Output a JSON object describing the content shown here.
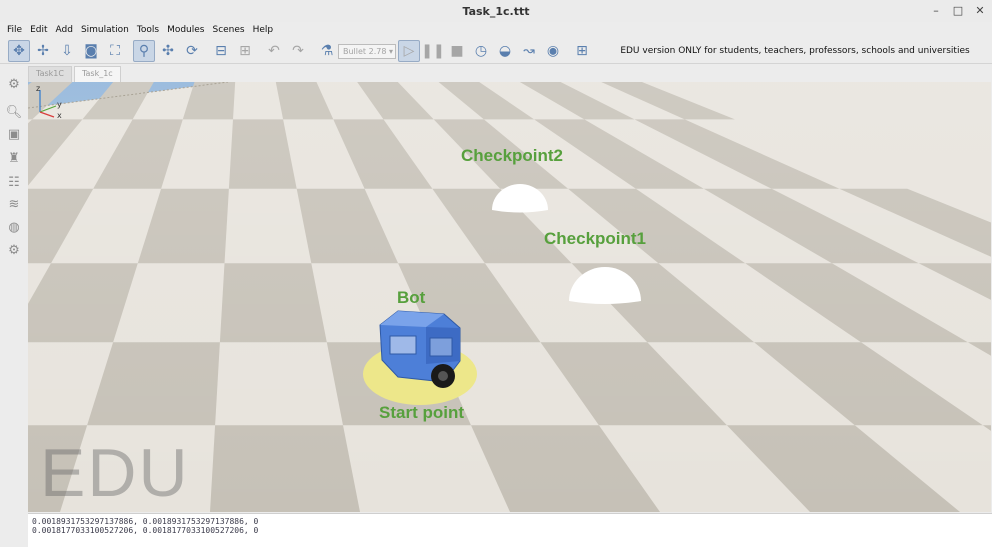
{
  "window": {
    "title": "Task_1c.ttt",
    "minimize_label": "–",
    "maximize_label": "□",
    "close_label": "✕"
  },
  "menu": [
    "File",
    "Edit",
    "Add",
    "Simulation",
    "Tools",
    "Modules",
    "Scenes",
    "Help"
  ],
  "toolbar": {
    "physics_engine": "Bullet 2.78",
    "banner": "EDU version ONLY for students, teachers, professors, schools and universities"
  },
  "tabs": [
    "Task1C",
    "Task_1c"
  ],
  "scene": {
    "labels": {
      "checkpoint2": "Checkpoint2",
      "checkpoint1": "Checkpoint1",
      "bot": "Bot",
      "start_point": "Start point"
    },
    "watermark": "EDU",
    "axes": {
      "y": "y",
      "z": "z",
      "x": "x"
    },
    "colors": {
      "label_green": "#57a03d",
      "start_pad": "#ede78a",
      "bot_blue": "#4d7fd8"
    }
  },
  "console": {
    "lines": [
      "0.0018931753297137886, 0.0018931753297137886, 0",
      "0.0018177033100527206, 0.0018177033100527206, 0"
    ]
  }
}
